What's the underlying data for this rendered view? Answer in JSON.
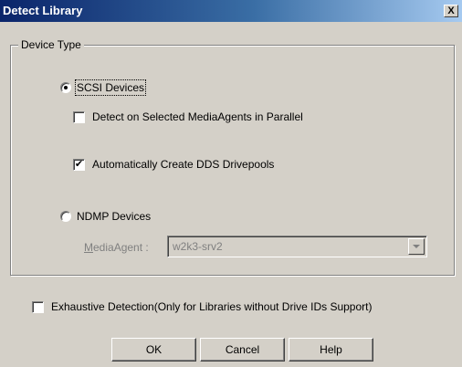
{
  "window": {
    "title": "Detect Library",
    "close_label": "X"
  },
  "device_type": {
    "legend": "Device Type",
    "scsi": {
      "label": "SCSI Devices",
      "selected": true
    },
    "detect_parallel": {
      "label": "Detect on Selected MediaAgents in Parallel",
      "checked": false
    },
    "auto_dds": {
      "label": "Automatically Create DDS Drivepools",
      "checked": true
    },
    "ndmp": {
      "label": "NDMP Devices",
      "selected": false
    },
    "media_agent": {
      "label_first": "M",
      "label_rest": "ediaAgent :",
      "value": "w2k3-srv2",
      "enabled": false
    }
  },
  "exhaustive": {
    "label": "Exhaustive Detection(Only for Libraries without Drive IDs Support)",
    "checked": false
  },
  "buttons": {
    "ok": "OK",
    "cancel": "Cancel",
    "help": "Help"
  },
  "icons": {
    "close": "close-icon",
    "radio_selected": "radio-selected-icon",
    "checkmark": "checkmark-icon",
    "dropdown": "chevron-down-icon"
  }
}
